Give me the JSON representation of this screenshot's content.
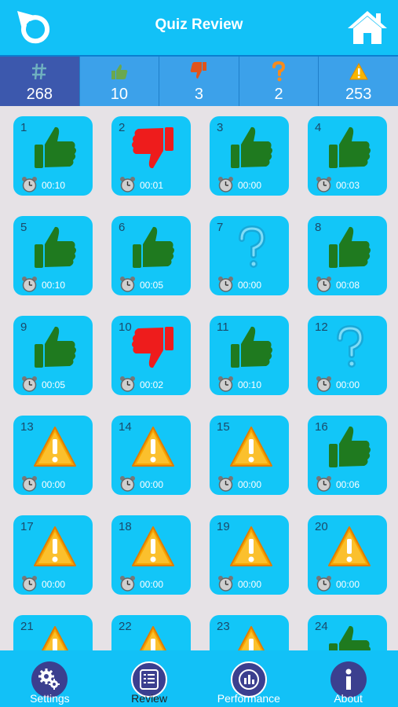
{
  "header": {
    "title": "Quiz Review",
    "back_icon": "refresh-back-icon",
    "home_icon": "home-icon"
  },
  "stats": [
    {
      "icon": "hash-icon",
      "value": "268",
      "selected": true
    },
    {
      "icon": "thumbs-up-icon",
      "value": "10"
    },
    {
      "icon": "thumbs-down-icon",
      "value": "3"
    },
    {
      "icon": "question-icon",
      "value": "2"
    },
    {
      "icon": "warning-icon",
      "value": "253"
    }
  ],
  "questions": [
    {
      "num": "1",
      "status": "correct",
      "time": "00:10"
    },
    {
      "num": "2",
      "status": "wrong",
      "time": "00:01"
    },
    {
      "num": "3",
      "status": "correct",
      "time": "00:00"
    },
    {
      "num": "4",
      "status": "correct",
      "time": "00:03"
    },
    {
      "num": "5",
      "status": "correct",
      "time": "00:10"
    },
    {
      "num": "6",
      "status": "correct",
      "time": "00:05"
    },
    {
      "num": "7",
      "status": "unsure",
      "time": "00:00"
    },
    {
      "num": "8",
      "status": "correct",
      "time": "00:08"
    },
    {
      "num": "9",
      "status": "correct",
      "time": "00:05"
    },
    {
      "num": "10",
      "status": "wrong",
      "time": "00:02"
    },
    {
      "num": "11",
      "status": "correct",
      "time": "00:10"
    },
    {
      "num": "12",
      "status": "unsure",
      "time": "00:00"
    },
    {
      "num": "13",
      "status": "unanswered",
      "time": "00:00"
    },
    {
      "num": "14",
      "status": "unanswered",
      "time": "00:00"
    },
    {
      "num": "15",
      "status": "unanswered",
      "time": "00:00"
    },
    {
      "num": "16",
      "status": "correct",
      "time": "00:06"
    },
    {
      "num": "17",
      "status": "unanswered",
      "time": "00:00"
    },
    {
      "num": "18",
      "status": "unanswered",
      "time": "00:00"
    },
    {
      "num": "19",
      "status": "unanswered",
      "time": "00:00"
    },
    {
      "num": "20",
      "status": "unanswered",
      "time": "00:00"
    },
    {
      "num": "21",
      "status": "unanswered",
      "time": ""
    },
    {
      "num": "22",
      "status": "unanswered",
      "time": ""
    },
    {
      "num": "23",
      "status": "unanswered",
      "time": ""
    },
    {
      "num": "24",
      "status": "correct",
      "time": ""
    }
  ],
  "tabs": [
    {
      "label": "Settings",
      "icon": "gears-icon"
    },
    {
      "label": "Review",
      "icon": "list-icon",
      "active": true
    },
    {
      "label": "Performance",
      "icon": "bar-chart-icon"
    },
    {
      "label": "About",
      "icon": "info-icon"
    }
  ],
  "colors": {
    "primary": "#12c1f7",
    "tile": "#12c6f8",
    "selected_stat": "#3c58ad",
    "stat_bar": "#3ca1ea",
    "correct": "#1f7a1f",
    "wrong": "#ee1c1c",
    "warning": "#f7a600",
    "tab_circle": "#3b3f8f"
  }
}
